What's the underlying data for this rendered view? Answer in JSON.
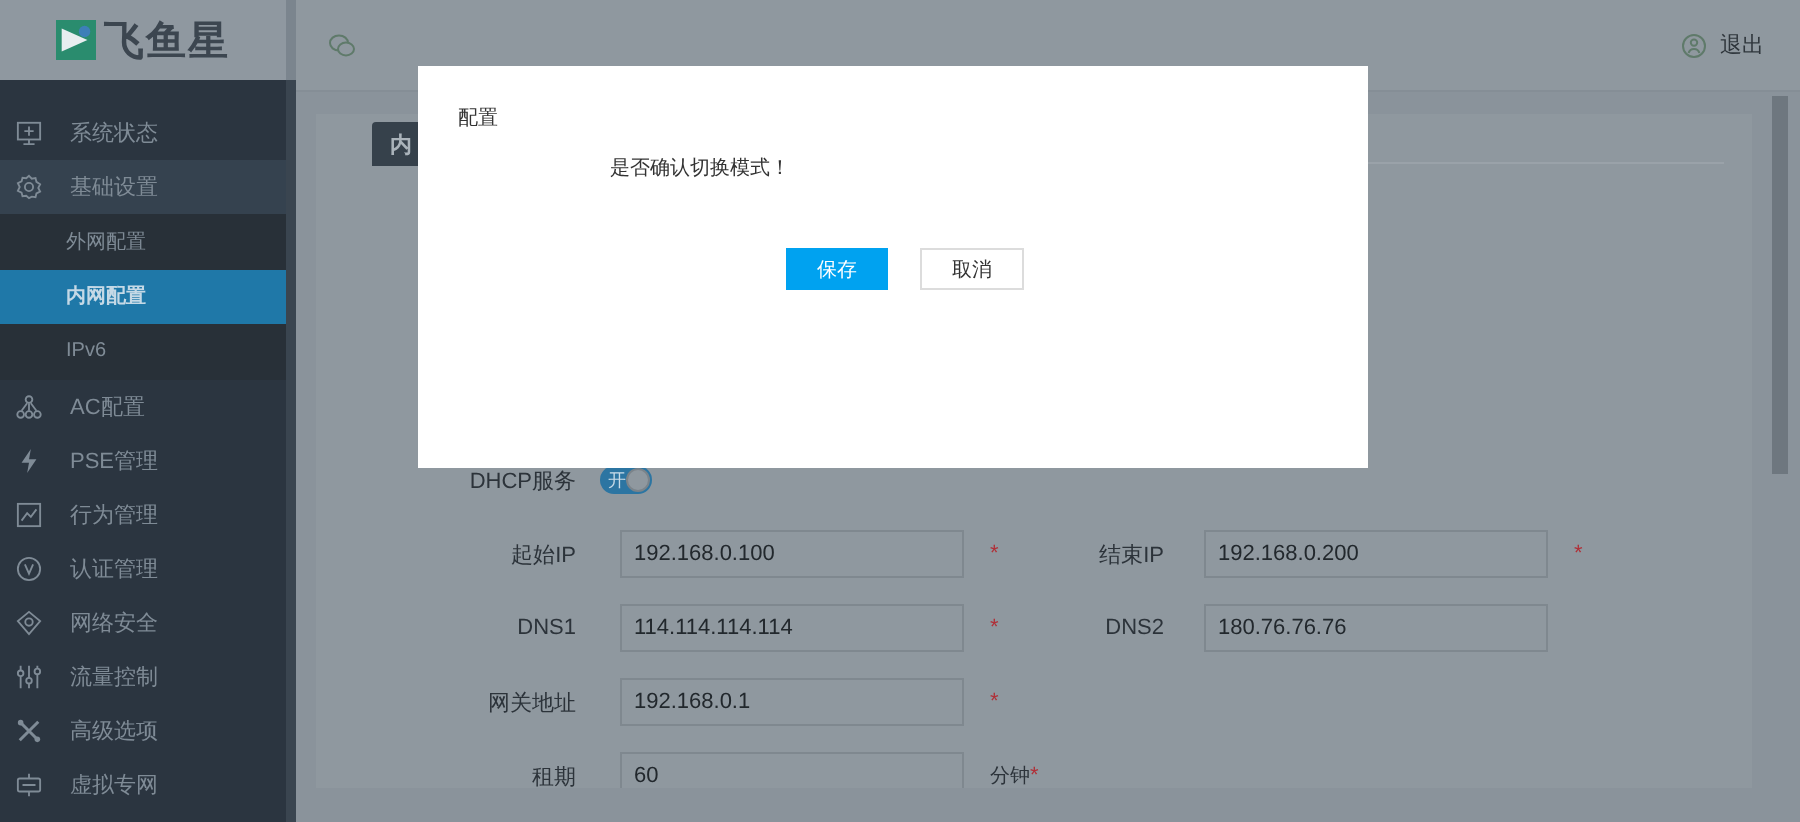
{
  "logo": {
    "text": "飞鱼星"
  },
  "sidebar": {
    "items": [
      {
        "label": "系统状态",
        "expanded": false
      },
      {
        "label": "基础设置",
        "expanded": true,
        "children": [
          {
            "label": "外网配置",
            "selected": false
          },
          {
            "label": "内网配置",
            "selected": true
          },
          {
            "label": "IPv6",
            "selected": false
          }
        ]
      },
      {
        "label": "AC配置",
        "expanded": false
      },
      {
        "label": "PSE管理",
        "expanded": false
      },
      {
        "label": "行为管理",
        "expanded": false
      },
      {
        "label": "认证管理",
        "expanded": false
      },
      {
        "label": "网络安全",
        "expanded": false
      },
      {
        "label": "流量控制",
        "expanded": false
      },
      {
        "label": "高级选项",
        "expanded": false
      },
      {
        "label": "虚拟专网",
        "expanded": false
      }
    ]
  },
  "header": {
    "logout": "退出"
  },
  "tabs": [
    {
      "label": "内",
      "selected": true
    }
  ],
  "dhcp": {
    "label": "DHCP服务",
    "toggle_text": "开",
    "on": true
  },
  "form_rows": [
    [
      {
        "label": "起始IP",
        "value": "192.168.0.100",
        "mark": "*"
      },
      {
        "label": "结束IP",
        "value": "192.168.0.200",
        "mark": "*"
      }
    ],
    [
      {
        "label": "DNS1",
        "value": "114.114.114.114",
        "mark": "*"
      },
      {
        "label": "DNS2",
        "value": "180.76.76.76"
      }
    ],
    [
      {
        "label": "网关地址",
        "value": "192.168.0.1",
        "mark": "*"
      }
    ],
    [
      {
        "label": "租期",
        "value": "60",
        "unit": "分钟",
        "mark": "*"
      }
    ]
  ],
  "dialog": {
    "title": "配置",
    "message": "是否确认切换模式！",
    "buttons": [
      {
        "label": "保存",
        "kind": "primary"
      },
      {
        "label": "取消",
        "kind": "default"
      }
    ]
  }
}
